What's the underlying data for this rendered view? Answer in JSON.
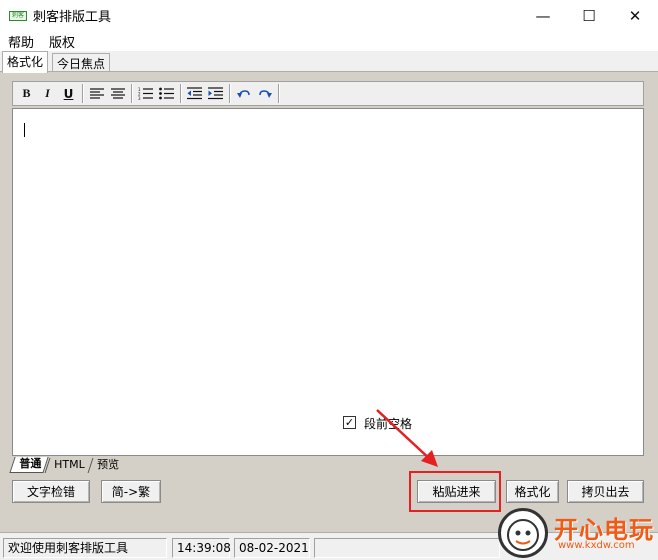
{
  "window": {
    "icon": "app-logo-icon",
    "icon_text": "刺客",
    "title": "刺客排版工具",
    "buttons": {
      "minimize": "—",
      "maximize": "☐",
      "close": "✕"
    }
  },
  "menu": {
    "items": [
      "帮助",
      "版权"
    ]
  },
  "top_tabs": [
    "格式化",
    "今日焦点"
  ],
  "toolbar": {
    "bold": "B",
    "italic": "I",
    "underline": "U",
    "icons": [
      "bold-icon",
      "italic-icon",
      "underline-icon",
      "align-left-icon",
      "align-center-icon",
      "ordered-list-icon",
      "unordered-list-icon",
      "outdent-icon",
      "indent-icon",
      "undo-icon",
      "redo-icon"
    ]
  },
  "editor": {
    "content": ""
  },
  "mode_tabs": [
    "普通",
    "HTML",
    "预览"
  ],
  "buttons": {
    "spell_check": "文字检错",
    "simp_to_trad": "简->繁",
    "paste_in": "粘贴进来",
    "format": "格式化",
    "copy_out": "拷贝出去"
  },
  "options": {
    "indent_label": "段前空格",
    "indent_checked": true
  },
  "status": {
    "message": "欢迎使用刺客排版工具",
    "time": "14:39:08",
    "date": "08-02-2021"
  },
  "watermark": {
    "title": "开心电玩",
    "url": "www.kxdw.com"
  },
  "colors": {
    "highlight": "#e52020",
    "panel": "#d4d0c8",
    "watermark": "#f05a14"
  }
}
